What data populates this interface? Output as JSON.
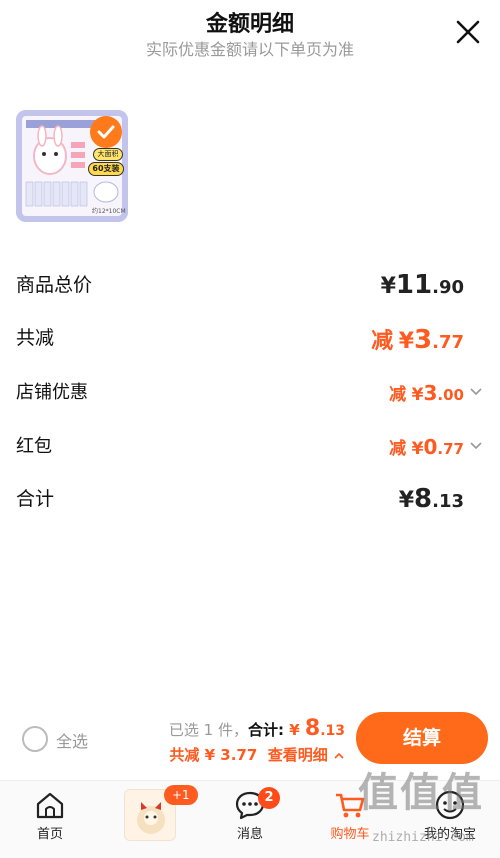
{
  "header": {
    "title": "金额明细",
    "subtitle": "实际优惠金额请以下单页为准"
  },
  "product": {
    "badge_text": "大面积",
    "count_text": "60支装",
    "size_text": "约12*10CM"
  },
  "rows": {
    "goods_total": {
      "label": "商品总价",
      "yen": "¥",
      "int": "11",
      "dec": ".90"
    },
    "total_discount": {
      "label": "共减",
      "minus": "减",
      "yen": "¥",
      "int": "3",
      "dec": ".77"
    },
    "shop_discount": {
      "label": "店铺优惠",
      "minus": "减",
      "yen": "¥",
      "int": "3",
      "dec": ".00"
    },
    "red_packet": {
      "label": "红包",
      "minus": "减",
      "yen": "¥",
      "int": "0",
      "dec": ".77"
    },
    "subtotal": {
      "label": "合计",
      "yen": "¥",
      "int": "8",
      "dec": ".13"
    }
  },
  "bottom_bar": {
    "select_all": "全选",
    "selected_count": "已选 1 件，",
    "total_label": "合计: ",
    "total_yen": "¥ ",
    "total_int": "8",
    "total_dec": ".13",
    "savings_text": "共减 ¥ 3.77",
    "details_link": "查看明细",
    "checkout": "结算"
  },
  "tabs": [
    {
      "label": "首页",
      "icon": "home-icon"
    },
    {
      "label": "",
      "icon": "promo-tile",
      "badge": "+1"
    },
    {
      "label": "消息",
      "icon": "message-icon",
      "badge": "2"
    },
    {
      "label": "购物车",
      "icon": "cart-icon",
      "active": true
    },
    {
      "label": "我的淘宝",
      "icon": "profile-icon"
    }
  ],
  "watermark": {
    "text": "值值值",
    "url": "zhizhizhi.com"
  },
  "colors": {
    "accent": "#ff5a1f",
    "button": "#ff6a1a",
    "muted": "#999999"
  }
}
